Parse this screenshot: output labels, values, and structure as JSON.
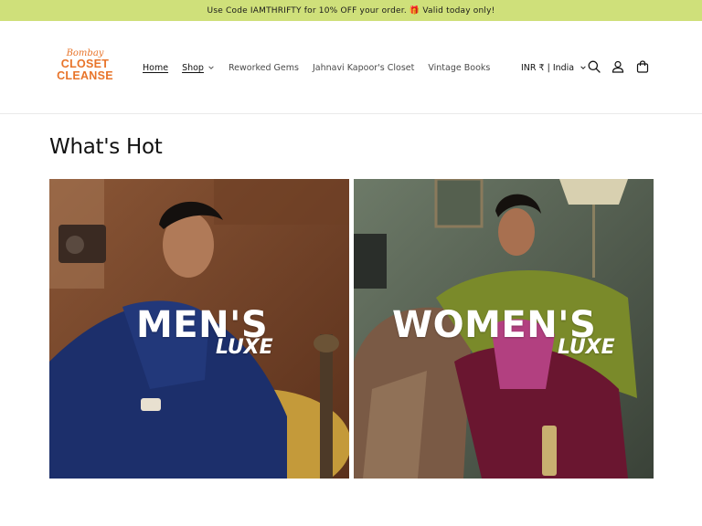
{
  "announcement": {
    "text": "Use Code IAMTHRIFTY for 10% OFF your order. 🎁 Valid today only!"
  },
  "logo": {
    "script": "Bombay",
    "line1": "CLOSET",
    "line2": "CLEANSE"
  },
  "nav": {
    "items": [
      {
        "label": "Home",
        "active": true
      },
      {
        "label": "Shop",
        "dropdown": true
      },
      {
        "label": "Reworked Gems"
      },
      {
        "label": "Jahnavi Kapoor's Closet"
      },
      {
        "label": "Vintage Books"
      }
    ]
  },
  "header": {
    "locale": "INR ₹ | India",
    "icons": [
      "search-icon",
      "account-icon",
      "cart-icon"
    ]
  },
  "section": {
    "title": "What's Hot"
  },
  "cards": {
    "mens": {
      "title": "MEN'S",
      "subtitle": "LUXE"
    },
    "womens": {
      "title": "WOMEN'S",
      "subtitle": "LUXE"
    }
  },
  "colors": {
    "announcement_bg": "#cfe07a",
    "brand_orange": "#e8742a",
    "text": "#121212"
  }
}
